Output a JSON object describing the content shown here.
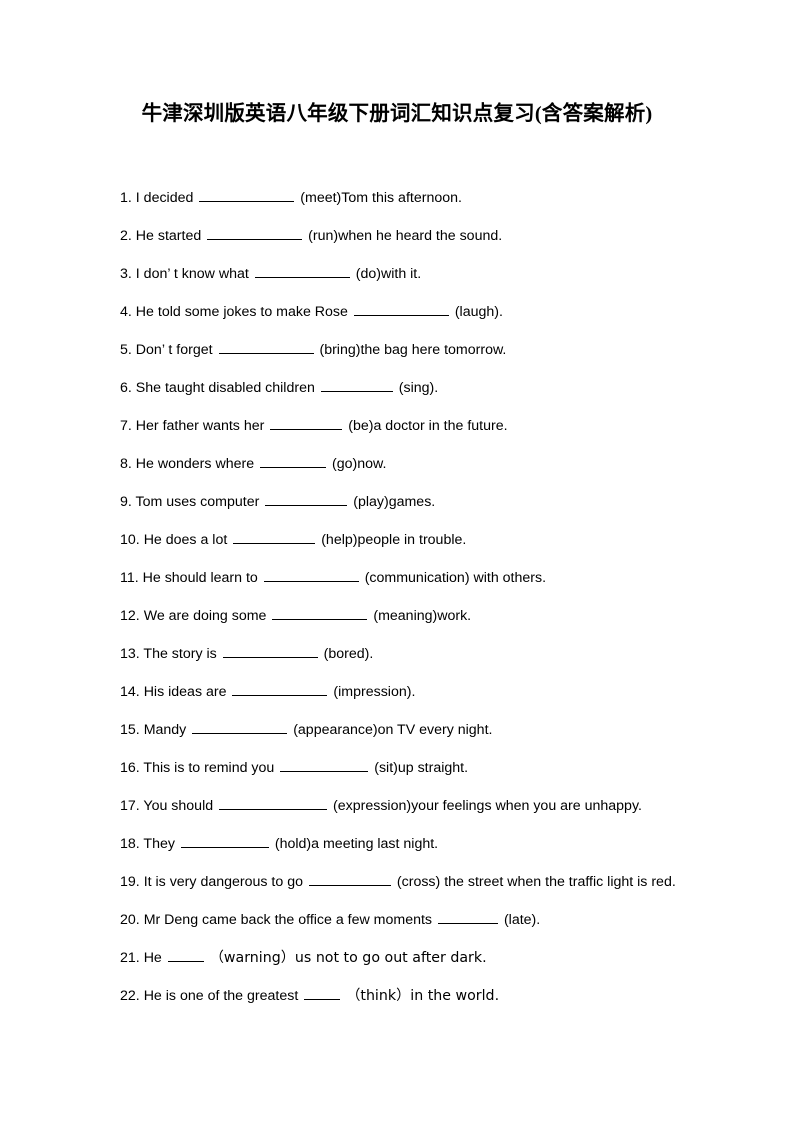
{
  "document": {
    "title": "牛津深圳版英语八年级下册词汇知识点复习(含答案解析)",
    "page_background": "#ffffff",
    "text_color": "#000000"
  },
  "questions": [
    {
      "number": "1.",
      "before": "I decided",
      "blank_width": 95,
      "after": "(meet)Tom this afternoon.",
      "paren_style": "half"
    },
    {
      "number": "2.",
      "before": "He started",
      "blank_width": 95,
      "after": "(run)when he heard the sound.",
      "paren_style": "half"
    },
    {
      "number": "3.",
      "before": "I don’ t know what",
      "blank_width": 95,
      "after": "(do)with it.",
      "paren_style": "half"
    },
    {
      "number": "4.",
      "before": "He told some jokes to make Rose",
      "blank_width": 95,
      "after": "(laugh).",
      "paren_style": "half"
    },
    {
      "number": "5.",
      "before": "Don’ t forget",
      "blank_width": 95,
      "after": "(bring)the bag here tomorrow.",
      "paren_style": "half"
    },
    {
      "number": "6.",
      "before": "She taught disabled children",
      "blank_width": 72,
      "after": "(sing).",
      "paren_style": "half"
    },
    {
      "number": "7.",
      "before": "Her father wants her",
      "blank_width": 72,
      "after": "(be)a doctor in the future.",
      "paren_style": "half"
    },
    {
      "number": "8.",
      "before": "He wonders where",
      "blank_width": 66,
      "after": "(go)now.",
      "paren_style": "half"
    },
    {
      "number": "9.",
      "before": "Tom uses computer",
      "blank_width": 82,
      "after": "(play)games.",
      "paren_style": "half"
    },
    {
      "number": "10.",
      "before": "He does a lot",
      "blank_width": 82,
      "after": "(help)people in trouble.",
      "paren_style": "half"
    },
    {
      "number": "11.",
      "before": "He should learn to",
      "blank_width": 95,
      "after": "(communication) with others.",
      "paren_style": "half"
    },
    {
      "number": "12.",
      "before": "We are doing some",
      "blank_width": 95,
      "after": "(meaning)work.",
      "paren_style": "half"
    },
    {
      "number": "13.",
      "before": "The story is",
      "blank_width": 95,
      "after": "(bored).",
      "paren_style": "half"
    },
    {
      "number": "14.",
      "before": "His ideas are",
      "blank_width": 95,
      "after": "(impression).",
      "paren_style": "half"
    },
    {
      "number": "15.",
      "before": "Mandy",
      "blank_width": 95,
      "after": "(appearance)on TV every night.",
      "paren_style": "half"
    },
    {
      "number": "16.",
      "before": "This is to remind you",
      "blank_width": 88,
      "after": "(sit)up straight.",
      "paren_style": "half"
    },
    {
      "number": "17.",
      "before": "You should",
      "blank_width": 108,
      "after": "(expression)your feelings when you are unhappy.",
      "paren_style": "half"
    },
    {
      "number": "18.",
      "before": "They",
      "blank_width": 88,
      "after": "(hold)a meeting last night.",
      "paren_style": "half"
    },
    {
      "number": "19.",
      "before": "It is very dangerous to go",
      "blank_width": 82,
      "after": "(cross) the street when the traffic light is red.",
      "paren_style": "half"
    },
    {
      "number": "20.",
      "before": "Mr Deng came back the office a few moments",
      "blank_width": 60,
      "after": "(late).",
      "paren_style": "half"
    },
    {
      "number": "21.",
      "before": "He",
      "blank_width": 36,
      "after": "（warning）us not to go out after dark.",
      "paren_style": "full"
    },
    {
      "number": "22.",
      "before": "He is one of the greatest",
      "blank_width": 36,
      "after": "（think）in the world.",
      "paren_style": "full"
    }
  ]
}
